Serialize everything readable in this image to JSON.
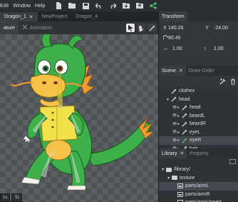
{
  "menu": [
    "Edit",
    "Window",
    "Help"
  ],
  "toolbar_icons": [
    "new-file-icon",
    "open-folder-icon",
    "save-icon",
    "undo-icon",
    "redo-icon",
    "import-icon",
    "export-icon",
    "share-icon"
  ],
  "doc_tabs": [
    {
      "label": "Dragon_1",
      "active": true,
      "closable": true
    },
    {
      "label": "NewProject",
      "active": false
    },
    {
      "label": "Dragon_4",
      "active": false
    }
  ],
  "mode_tabs": [
    {
      "label": "ature",
      "active": true
    },
    {
      "label": "Animation",
      "active": false
    }
  ],
  "canvas_bottom": [
    {
      "label": "1x"
    },
    {
      "label": "To"
    }
  ],
  "transform": {
    "title": "Transform",
    "x_label": "X",
    "x_value": "140.26",
    "y_label": "Y",
    "y_value": "-24.00",
    "rotation": "80.45",
    "scale_x": "1.00",
    "scale_y": "1.00"
  },
  "scene": {
    "tab_scene": "Scene",
    "tab_draw_order": "Draw Order",
    "items": [
      {
        "label": "clothes",
        "indent": 1,
        "arrow": "",
        "selected": false
      },
      {
        "label": "head",
        "indent": 1,
        "arrow": "▾",
        "selected": false
      },
      {
        "label": "head",
        "indent": 2,
        "arrow": "▸",
        "selected": false
      },
      {
        "label": "beardL",
        "indent": 2,
        "arrow": "▸",
        "selected": false
      },
      {
        "label": "beardR",
        "indent": 2,
        "arrow": "▸",
        "selected": false
      },
      {
        "label": "eyeL",
        "indent": 2,
        "arrow": "▸",
        "selected": false
      },
      {
        "label": "eyeR",
        "indent": 2,
        "arrow": "▸",
        "selected": true
      },
      {
        "label": "hair",
        "indent": 2,
        "arrow": "▸",
        "selected": false
      }
    ]
  },
  "library": {
    "tab_library": "Library",
    "tab_property": "Property",
    "items": [
      {
        "label": "/library/",
        "indent": 0,
        "type": "folder",
        "arrow": "▾",
        "selected": false
      },
      {
        "label": "texture",
        "indent": 1,
        "type": "folder",
        "arrow": "▾",
        "selected": false
      },
      {
        "label": "parts/armL",
        "indent": 2,
        "type": "image",
        "arrow": "",
        "selected": true
      },
      {
        "label": "parts/armR",
        "indent": 2,
        "type": "image",
        "arrow": "",
        "selected": false
      },
      {
        "label": "parts/armUpperL",
        "indent": 2,
        "type": "image",
        "arrow": "",
        "selected": false
      }
    ]
  },
  "colors": {
    "bone_color": "#f0d33a",
    "bone_selected": "#4fc15a",
    "dragon_green": "#3db04a",
    "dragon_belly": "#f6c24a"
  }
}
